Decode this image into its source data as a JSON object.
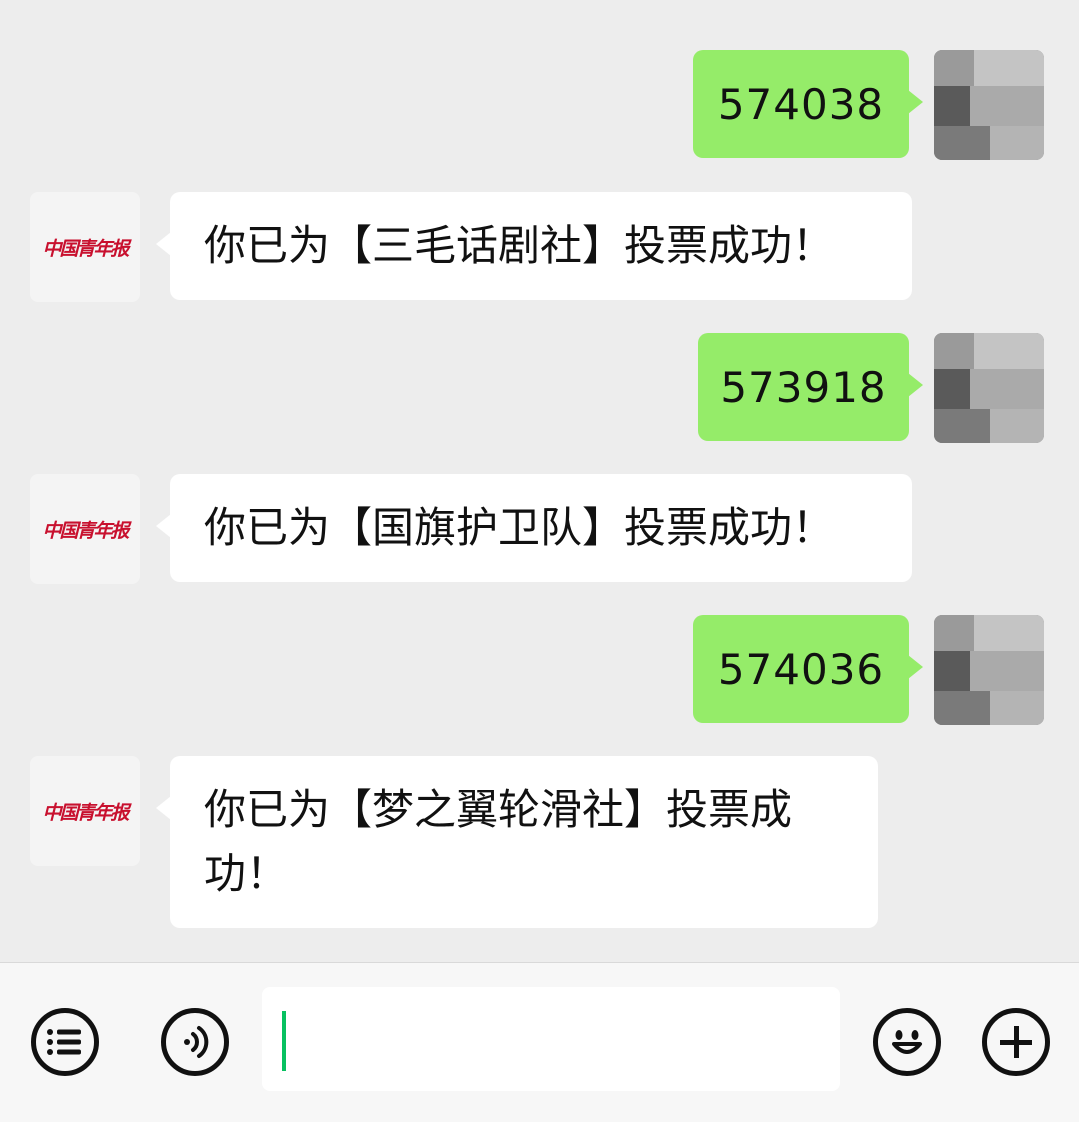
{
  "messages": [
    {
      "sender": "me",
      "text": "574038"
    },
    {
      "sender": "other",
      "text": "你已为【三毛话剧社】投票成功！"
    },
    {
      "sender": "me",
      "text": "573918"
    },
    {
      "sender": "other",
      "text": "你已为【国旗护卫队】投票成功！"
    },
    {
      "sender": "me",
      "text": "574036"
    },
    {
      "sender": "other",
      "text": "你已为【梦之翼轮滑社】投票成功！"
    }
  ],
  "other_avatar": {
    "logo_text": "中国青年报",
    "color": "#c8102e"
  },
  "colors": {
    "my_bubble": "#95ec69",
    "other_bubble": "#ffffff",
    "background": "#ededed",
    "cursor": "#07c160"
  },
  "input_bar": {
    "left_icons": [
      "list-icon",
      "voice-icon"
    ],
    "right_icons": [
      "emoji-icon",
      "plus-icon"
    ],
    "input_value": ""
  }
}
